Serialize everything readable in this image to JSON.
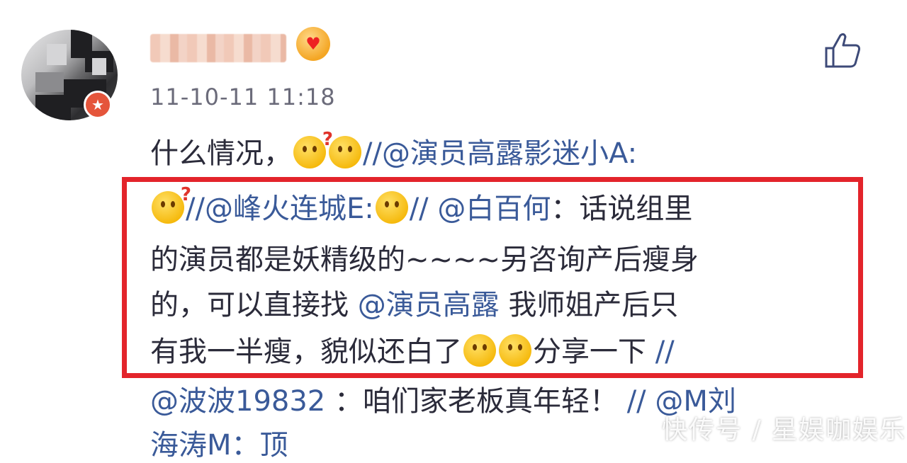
{
  "post": {
    "timestamp": "11-10-11 11:18",
    "lines": {
      "l1_text": "什么情况，",
      "l1_sep": "//",
      "l1_mention": "@演员高露影迷小A:",
      "l2_sep1": "//",
      "l2_mention1": "@峰火连城E:",
      "l2_sep2": "//",
      "l2_mention2": "@白百何",
      "l2_text": "：话说组里",
      "l3_text": "的演员都是妖精级的~~~~另咨询产后瘦身",
      "l4_text1": "的，可以直接找",
      "l4_mention": "@演员高露",
      "l4_text2": "我师姐产后只",
      "l5_text1": "有我一半瘦，貌似还白了",
      "l5_text2": "分享一下",
      "l5_sep": "//",
      "l6_mention1": "@波波19832",
      "l6_text": "：咱们家老板真年轻！",
      "l6_sep": "//",
      "l6_mention2": "@M刘",
      "l7_text": "海涛M：顶"
    }
  },
  "watermark": "快传号 / 星娱咖娱乐",
  "icons": {
    "like": "thumbs-up-icon",
    "vip": "vip-emoji-icon",
    "badge": "verified-badge-icon"
  },
  "colors": {
    "text": "#2b2b3a",
    "mention": "#3a5a99",
    "highlight": "#e3242b",
    "timestamp": "#6b6b7a"
  }
}
